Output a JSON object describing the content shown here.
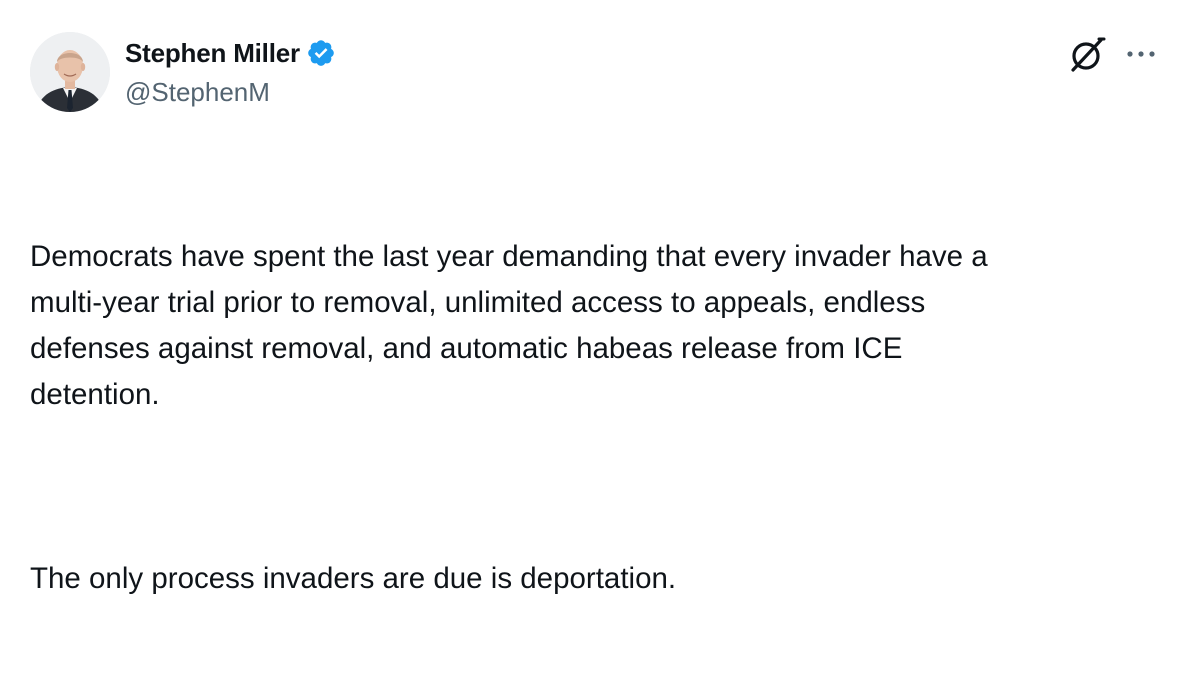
{
  "author": {
    "display_name": "Stephen Miller",
    "handle": "@StephenM",
    "verified": true,
    "verified_color": "#1d9bf0"
  },
  "icons": {
    "avatar": "profile-photo",
    "verified": "verified-badge-icon",
    "grok": "grok-icon",
    "more": "more-horizontal-icon"
  },
  "tweet": {
    "paragraphs": [
      "Democrats have spent the last year demanding that every invader have a\nmulti-year trial prior to removal, unlimited access to appeals, endless\ndefenses against removal, and automatic habeas release from ICE\ndetention.",
      "The only process invaders are due is deportation."
    ]
  },
  "colors": {
    "text": "#0f1419",
    "secondary_text": "#536471",
    "background": "#ffffff"
  }
}
